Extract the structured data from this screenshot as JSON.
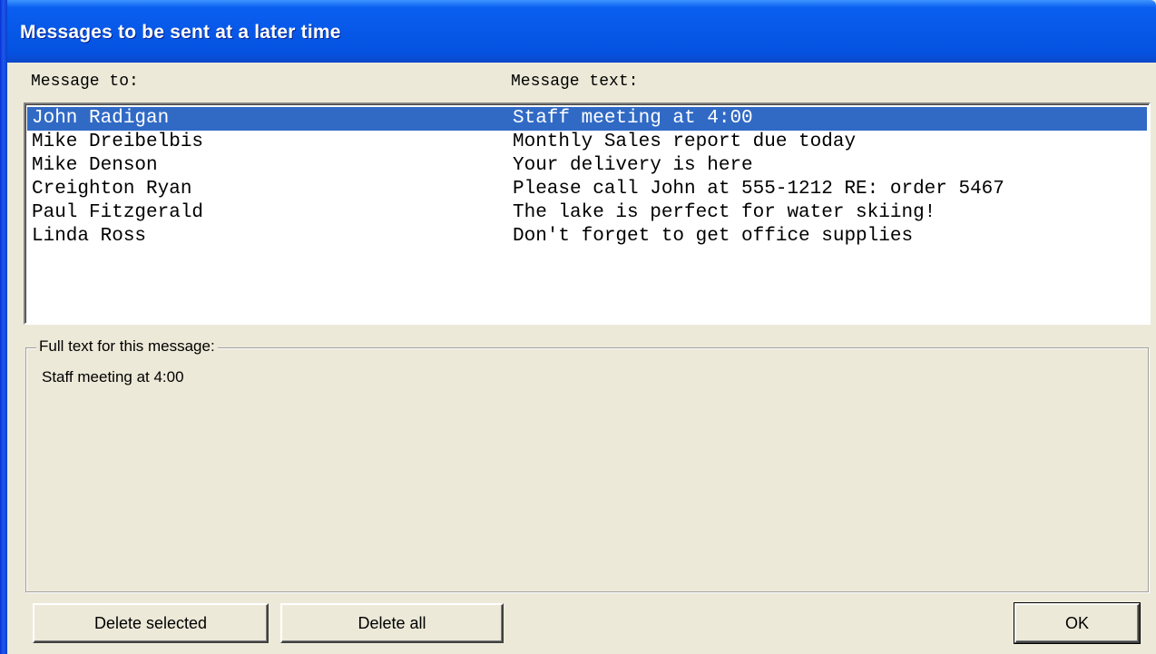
{
  "window": {
    "title": "Messages to be sent at a later time"
  },
  "columns": {
    "to": "Message to:",
    "text": "Message text:"
  },
  "messages": [
    {
      "to": "John Radigan",
      "text": "Staff meeting at 4:00",
      "selected": true
    },
    {
      "to": "Mike Dreibelbis",
      "text": "Monthly Sales report due today",
      "selected": false
    },
    {
      "to": "Mike Denson",
      "text": "Your delivery is here",
      "selected": false
    },
    {
      "to": "Creighton Ryan",
      "text": "Please call John at 555-1212 RE: order 5467",
      "selected": false
    },
    {
      "to": "Paul Fitzgerald",
      "text": "The lake is perfect for water skiing!",
      "selected": false
    },
    {
      "to": "Linda Ross",
      "text": "Don't forget to get office supplies",
      "selected": false
    }
  ],
  "full_text": {
    "label": "Full text for this message:",
    "value": "Staff meeting at 4:00"
  },
  "buttons": {
    "delete_selected": "Delete selected",
    "delete_all": "Delete all",
    "ok": "OK"
  },
  "colors": {
    "title_bar": "#0758e8",
    "selection": "#316ac5",
    "dialog_face": "#ece9d8"
  }
}
